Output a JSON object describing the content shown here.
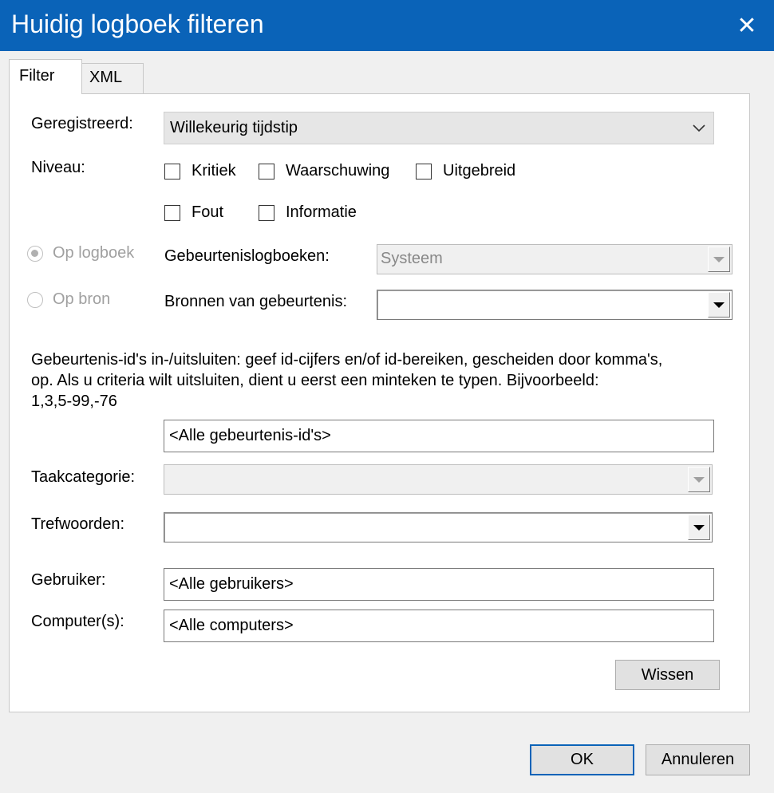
{
  "window": {
    "title": "Huidig logboek filteren",
    "close_symbol": "✕"
  },
  "tabs": [
    {
      "label": "Filter",
      "selected": true
    },
    {
      "label": "XML",
      "selected": false
    }
  ],
  "logged": {
    "label": "Geregistreerd:",
    "value": "Willekeurig tijdstip"
  },
  "level": {
    "label": "Niveau:",
    "options": [
      {
        "label": "Kritiek",
        "checked": false
      },
      {
        "label": "Waarschuwing",
        "checked": false
      },
      {
        "label": "Uitgebreid",
        "checked": false
      },
      {
        "label": "Fout",
        "checked": false
      },
      {
        "label": "Informatie",
        "checked": false
      }
    ]
  },
  "source_mode": {
    "by_log": {
      "label": "Op logboek",
      "selected": true
    },
    "by_source": {
      "label": "Op bron",
      "selected": false
    }
  },
  "event_logs": {
    "label": "Gebeurtenislogboeken:",
    "value": "Systeem"
  },
  "event_sources": {
    "label": "Bronnen van gebeurtenis:",
    "value": ""
  },
  "event_ids": {
    "description": "Gebeurtenis-id's in-/uitsluiten: geef id-cijfers en/of id-bereiken, gescheiden door komma's,\nop. Als u criteria wilt uitsluiten, dient u eerst een minteken te typen. Bijvoorbeeld:\n1,3,5-99,-76",
    "value": "<Alle gebeurtenis-id's>"
  },
  "task_category": {
    "label": "Taakcategorie:",
    "value": ""
  },
  "keywords": {
    "label": "Trefwoorden:",
    "value": ""
  },
  "user": {
    "label": "Gebruiker:",
    "value": "<Alle gebruikers>"
  },
  "computer": {
    "label": "Computer(s):",
    "value": "<Alle computers>"
  },
  "buttons": {
    "clear": "Wissen",
    "ok": "OK",
    "cancel": "Annuleren"
  },
  "colors": {
    "titlebar": "#0a63b8",
    "dialog_bg": "#f0f0f0",
    "panel_bg": "#ffffff",
    "disabled_text": "#a0a0a0"
  }
}
